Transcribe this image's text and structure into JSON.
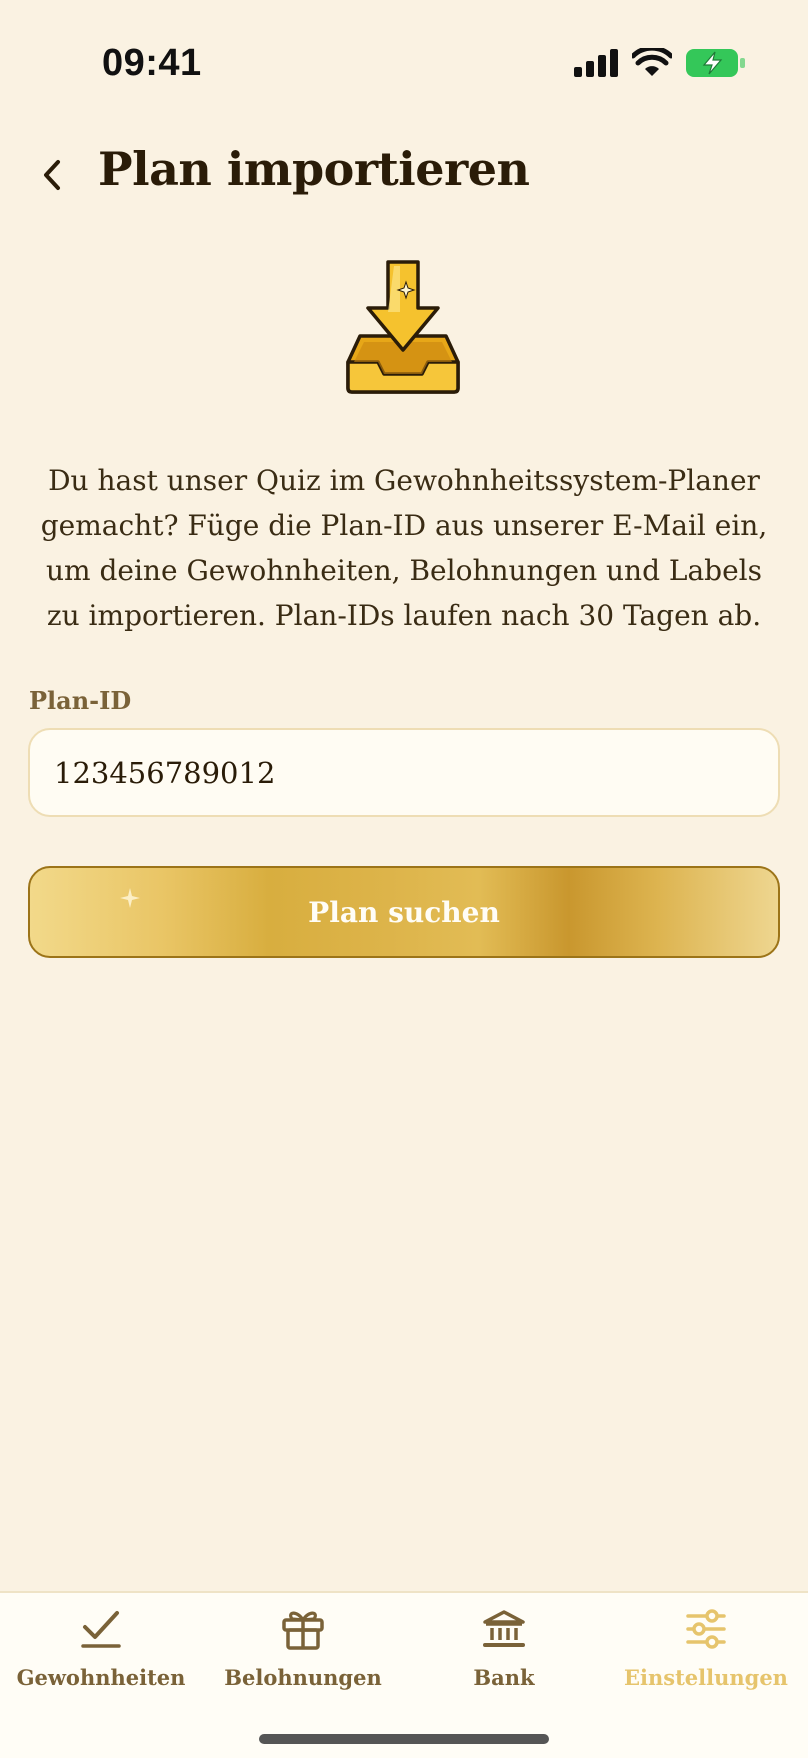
{
  "status_bar": {
    "time": "09:41",
    "icons": [
      "cellular-signal-icon",
      "wifi-icon",
      "battery-charging-icon"
    ]
  },
  "header": {
    "back_icon": "chevron-left-icon",
    "title": "Plan importieren"
  },
  "hero": {
    "icon": "download-inbox-icon"
  },
  "description": "Du hast unser Quiz im Gewohnheitssystem-Planer gemacht? Füge die Plan-ID aus unserer E-Mail ein, um deine Gewohnheiten, Belohnungen und Labels zu importieren. Plan-IDs laufen nach 30 Tagen ab.",
  "form": {
    "label": "Plan-ID",
    "value": "123456789012",
    "button_label": "Plan suchen"
  },
  "nav": {
    "items": [
      {
        "label": "Gewohnheiten",
        "icon": "checkmark-icon",
        "active": false
      },
      {
        "label": "Belohnungen",
        "icon": "gift-icon",
        "active": false
      },
      {
        "label": "Bank",
        "icon": "bank-icon",
        "active": false
      },
      {
        "label": "Einstellungen",
        "icon": "sliders-icon",
        "active": true
      }
    ]
  },
  "colors": {
    "background": "#FAF2E2",
    "accent_gold": "#D8AE3F",
    "nav_inactive": "#7A6238",
    "nav_active": "#E6C46C"
  }
}
